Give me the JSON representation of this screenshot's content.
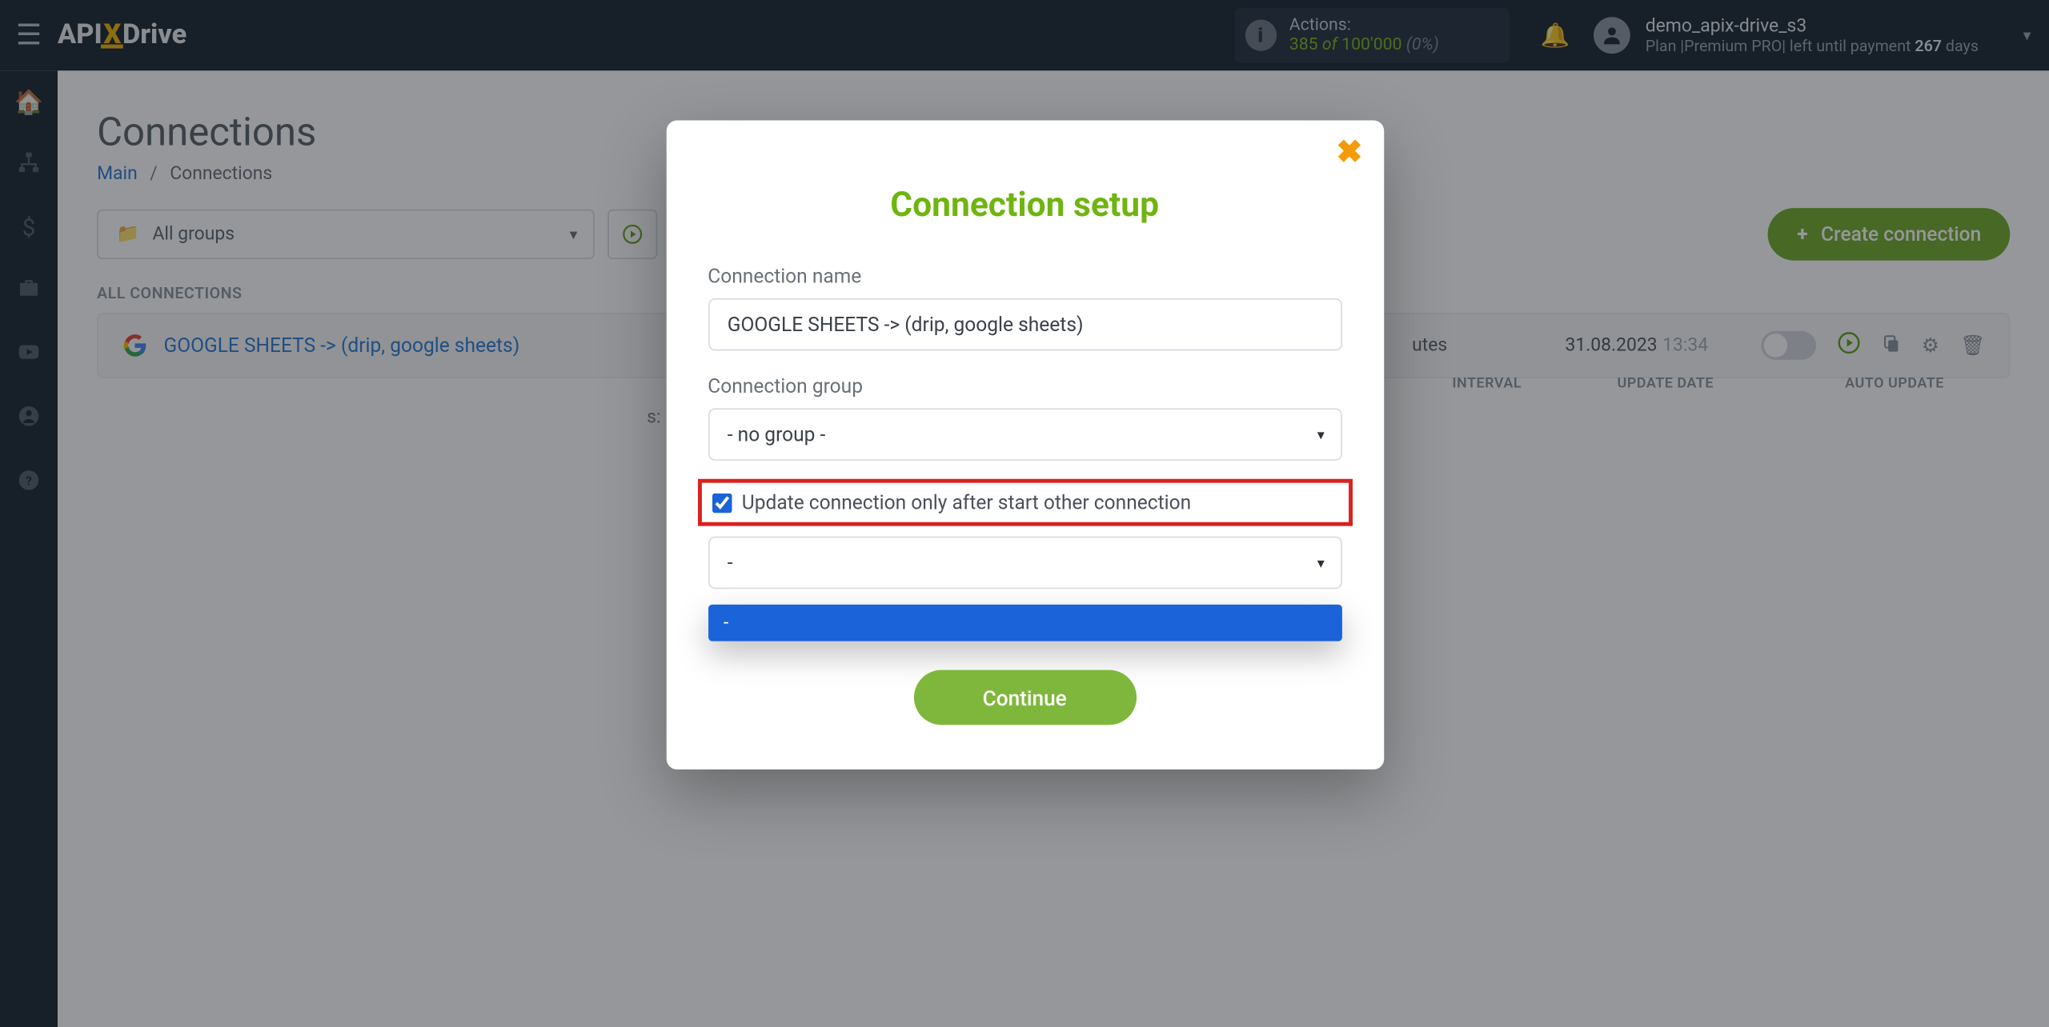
{
  "topbar": {
    "logo_api": "API",
    "logo_x": "X",
    "logo_drive": "Drive",
    "actions_label": "Actions:",
    "actions_used": "385",
    "actions_of": "of",
    "actions_total": "100'000",
    "actions_pct": "(0%)",
    "username": "demo_apix-drive_s3",
    "plan_prefix": "Plan |",
    "plan_name": "Premium PRO",
    "plan_mid": "| left until payment",
    "plan_days_num": "267",
    "plan_days_word": "days"
  },
  "page": {
    "title": "Connections",
    "bc_main": "Main",
    "bc_sep": "/",
    "bc_current": "Connections",
    "groups_selected": "All groups",
    "create_btn": "Create connection",
    "section": "ALL CONNECTIONS",
    "col_interval": "INTERVAL",
    "col_update": "UPDATE DATE",
    "col_auto": "AUTO UPDATE",
    "footer_text_partial": "s:"
  },
  "connection": {
    "name": "GOOGLE SHEETS -> (drip, google sheets)",
    "interval_partial": "utes",
    "date": "31.08.2023",
    "time": "13:34"
  },
  "modal": {
    "title": "Connection setup",
    "name_label": "Connection name",
    "name_value": "GOOGLE SHEETS -> (drip, google sheets)",
    "group_label": "Connection group",
    "group_value": "- no group -",
    "checkbox_label": "Update connection only after start other connection",
    "dep_value": "-",
    "dropdown_option": "-",
    "continue": "Continue"
  }
}
